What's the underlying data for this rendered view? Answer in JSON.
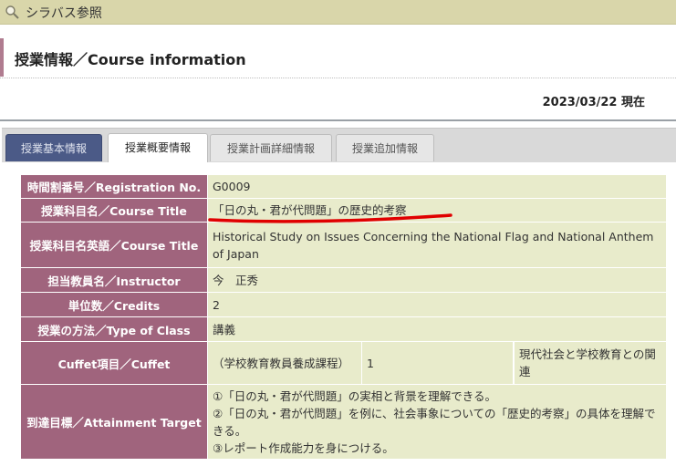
{
  "topbar": {
    "title": "シラバス参照",
    "icon": "search-icon"
  },
  "section": {
    "title": "授業情報／Course information"
  },
  "date": "2023/03/22 現在",
  "tabs": [
    {
      "label": "授業基本情報"
    },
    {
      "label": "授業概要情報"
    },
    {
      "label": "授業計画詳細情報"
    },
    {
      "label": "授業追加情報"
    }
  ],
  "rows": {
    "registration": {
      "label": "時間割番号／Registration No.",
      "value": "G0009"
    },
    "title": {
      "label": "授業科目名／Course Title",
      "value": "「日の丸・君が代問題」の歴史的考察"
    },
    "title_en": {
      "label": "授業科目名英語／Course Title",
      "value": "Historical Study on Issues Concerning the National Flag and National Anthem of Japan"
    },
    "instructor": {
      "label": "担当教員名／Instructor",
      "value": "今　正秀"
    },
    "credits": {
      "label": "単位数／Credits",
      "value": "2"
    },
    "type": {
      "label": "授業の方法／Type of Class",
      "value": "講義"
    },
    "cuffet": {
      "label": "Cuffet項目／Cuffet",
      "c1": "（学校教育教員養成課程）",
      "c2": "1",
      "c3": "",
      "c4": "現代社会と学校教育との関連"
    },
    "attainment": {
      "label": "到達目標／Attainment Target",
      "lines": [
        "①「日の丸・君が代問題」の実相と背景を理解できる。",
        "②「日の丸・君が代問題」を例に、社会事象についての「歴史的考察」の具体を理解できる。",
        "③レポート作成能力を身につける。"
      ]
    }
  },
  "colors": {
    "header": "#a0647d",
    "cell": "#e8ebcb",
    "tab_dark": "#4b5a87",
    "annotation": "#e00000"
  }
}
